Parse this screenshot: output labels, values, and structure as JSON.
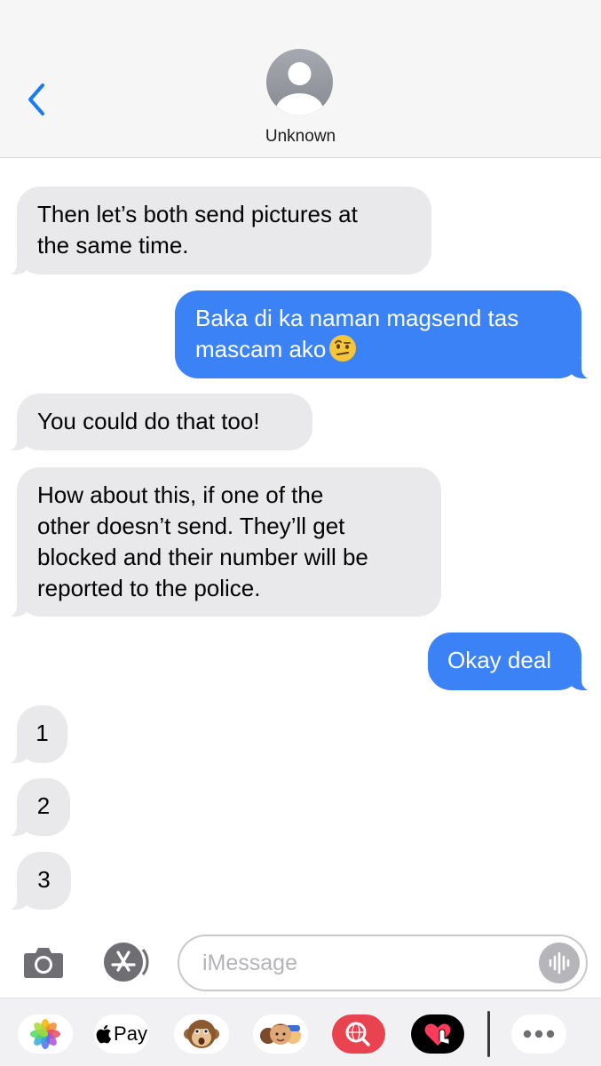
{
  "header": {
    "contact_name": "Unknown",
    "back_icon": "chevron-left-icon",
    "avatar_icon": "person-silhouette-icon"
  },
  "messages": [
    {
      "direction": "incoming",
      "text": "Then let’s both send pictures at\nthe same time."
    },
    {
      "direction": "outgoing",
      "text": "Baka di ka naman magsend tas\nmascam ako",
      "emoji": "face-with-raised-eyebrow"
    },
    {
      "direction": "incoming",
      "text": "You could do that too!"
    },
    {
      "direction": "incoming",
      "text": "How about this, if one of the\nother doesn’t send. They’ll get\nblocked and their number will be\nreported to the police."
    },
    {
      "direction": "outgoing",
      "text": "Okay deal"
    },
    {
      "direction": "incoming",
      "text": "1"
    },
    {
      "direction": "incoming",
      "text": "2"
    },
    {
      "direction": "incoming",
      "text": "3"
    }
  ],
  "input_bar": {
    "placeholder": "iMessage",
    "camera_icon": "camera-icon",
    "apps_icon": "app-store-icon",
    "audio_icon": "audio-waveform-icon"
  },
  "app_drawer": {
    "pay_label": "Pay",
    "apps": [
      "photos-icon",
      "apple-pay-icon",
      "monkey-animoji-icon",
      "memoji-icon",
      "web-image-search-icon",
      "digital-touch-icon",
      "more-icon"
    ]
  },
  "colors": {
    "outgoing_bubble": "#3b82f6",
    "incoming_bubble": "#e9e9eb",
    "accent": "#1a7cf5"
  }
}
